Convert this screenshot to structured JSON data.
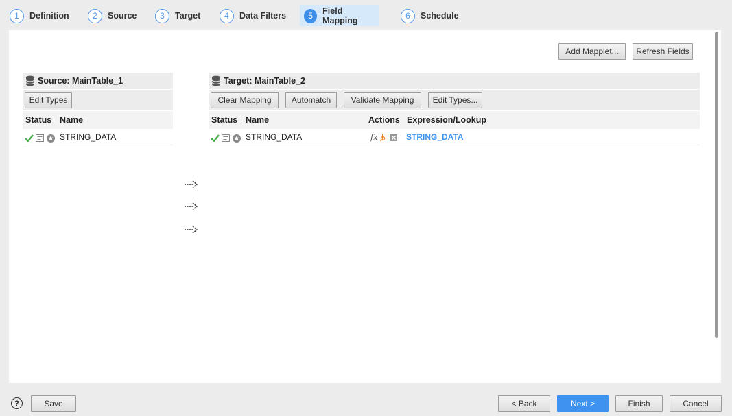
{
  "steps": [
    {
      "num": "1",
      "label": "Definition"
    },
    {
      "num": "2",
      "label": "Source"
    },
    {
      "num": "3",
      "label": "Target"
    },
    {
      "num": "4",
      "label": "Data Filters"
    },
    {
      "num": "5",
      "label": "Field Mapping"
    },
    {
      "num": "6",
      "label": "Schedule"
    }
  ],
  "active_step": "Field Mapping",
  "top_buttons": {
    "add_mapplet": "Add Mapplet...",
    "refresh_fields": "Refresh Fields"
  },
  "source": {
    "title": "Source: MainTable_1",
    "edit_types": "Edit Types",
    "columns": {
      "status": "Status",
      "name": "Name"
    },
    "rows": [
      {
        "name": "STRING_DATA"
      }
    ]
  },
  "target": {
    "title": "Target: MainTable_2",
    "toolbar": {
      "clear": "Clear Mapping",
      "automatch": "Automatch",
      "validate": "Validate Mapping",
      "edit_types": "Edit Types..."
    },
    "columns": {
      "status": "Status",
      "name": "Name",
      "actions": "Actions",
      "expression": "Expression/Lookup"
    },
    "rows": [
      {
        "name": "STRING_DATA",
        "expression": "STRING_DATA",
        "action_fx": "fx"
      }
    ]
  },
  "footer": {
    "help": "?",
    "save": "Save",
    "back": "< Back",
    "next": "Next >",
    "finish": "Finish",
    "cancel": "Cancel"
  },
  "colors": {
    "accent": "#3d93ef",
    "success": "#4caf50",
    "active_step_bg": "#d6e9fb"
  },
  "icons": [
    "database-icon",
    "check-icon",
    "details-icon",
    "star-badge-icon",
    "function-icon",
    "lookup-icon",
    "clear-icon",
    "mapping-arrow-icon",
    "help-icon"
  ]
}
